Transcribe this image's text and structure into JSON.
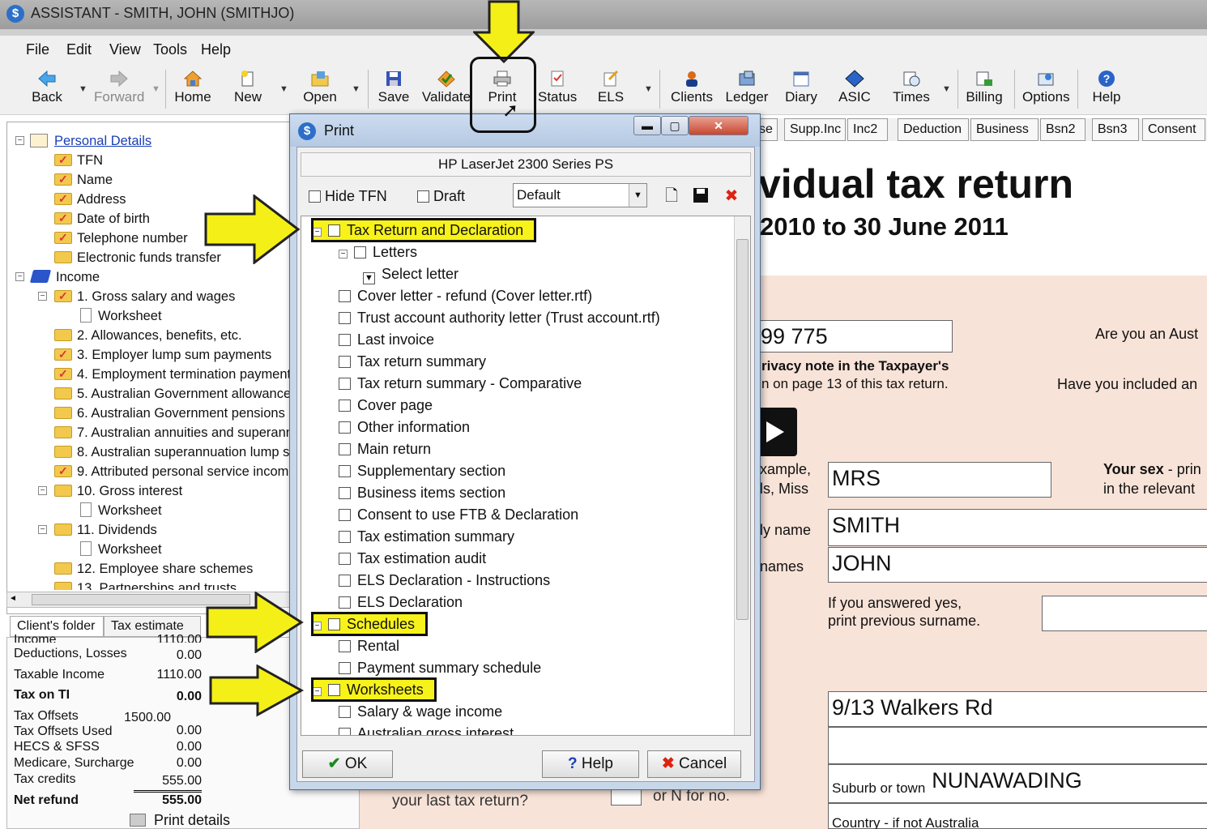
{
  "window": {
    "title": "ASSISTANT - SMITH, JOHN (SMITHJO)"
  },
  "menu": [
    "File",
    "Edit",
    "View",
    "Tools",
    "Help"
  ],
  "toolbar": [
    {
      "label": "Back",
      "icon": "back-arrow-icon"
    },
    {
      "label": "Forward",
      "icon": "forward-arrow-icon",
      "disabled": true
    },
    {
      "label": "Home",
      "icon": "home-icon"
    },
    {
      "label": "New",
      "icon": "new-icon"
    },
    {
      "label": "Open",
      "icon": "open-folder-icon"
    },
    {
      "label": "Save",
      "icon": "save-icon"
    },
    {
      "label": "Validate",
      "icon": "validate-icon"
    },
    {
      "label": "Print",
      "icon": "printer-icon"
    },
    {
      "label": "Status",
      "icon": "status-icon"
    },
    {
      "label": "ELS",
      "icon": "els-icon"
    },
    {
      "label": "Clients",
      "icon": "clients-icon"
    },
    {
      "label": "Ledger",
      "icon": "ledger-icon"
    },
    {
      "label": "Diary",
      "icon": "diary-icon"
    },
    {
      "label": "ASIC",
      "icon": "asic-icon"
    },
    {
      "label": "Times",
      "icon": "times-icon"
    },
    {
      "label": "Billing",
      "icon": "billing-icon"
    },
    {
      "label": "Options",
      "icon": "options-icon"
    },
    {
      "label": "Help",
      "icon": "help-icon"
    }
  ],
  "tree": [
    {
      "label": "Personal Details",
      "level": 0,
      "link": true
    },
    {
      "label": "TFN",
      "level": 1
    },
    {
      "label": "Name",
      "level": 1
    },
    {
      "label": "Address",
      "level": 1
    },
    {
      "label": "Date of birth",
      "level": 1
    },
    {
      "label": "Telephone number",
      "level": 1
    },
    {
      "label": "Electronic funds transfer",
      "level": 1
    },
    {
      "label": "Income",
      "level": 0
    },
    {
      "label": "1. Gross salary and wages",
      "level": 1
    },
    {
      "label": "Worksheet",
      "level": 2
    },
    {
      "label": "2. Allowances, benefits, etc.",
      "level": 1
    },
    {
      "label": "3. Employer lump sum payments",
      "level": 1
    },
    {
      "label": "4. Employment termination payments",
      "level": 1
    },
    {
      "label": "5. Australian Government allowances",
      "level": 1
    },
    {
      "label": "6. Australian Government pensions a",
      "level": 1
    },
    {
      "label": "7. Australian annuities and superann",
      "level": 1
    },
    {
      "label": "8. Australian superannuation lump su",
      "level": 1
    },
    {
      "label": "9. Attributed personal service income",
      "level": 1
    },
    {
      "label": "10. Gross interest",
      "level": 1
    },
    {
      "label": "Worksheet",
      "level": 2
    },
    {
      "label": "11. Dividends",
      "level": 1
    },
    {
      "label": "Worksheet",
      "level": 2
    },
    {
      "label": "12. Employee share schemes",
      "level": 1
    },
    {
      "label": "13. Partnerships and trusts",
      "level": 1
    }
  ],
  "left_tabs": [
    "Client's folder",
    "Tax estimate"
  ],
  "summary": {
    "rows": [
      {
        "label": "Income",
        "value": "1110.00"
      },
      {
        "label": "Deductions, Losses",
        "value": "0.00"
      },
      {
        "label": "Taxable Income",
        "value": "1110.00"
      },
      {
        "label": "Tax on TI",
        "value": "0.00",
        "bold": true
      },
      {
        "label": "Tax Offsets",
        "value": "1500.00"
      },
      {
        "label": "Tax Offsets Used",
        "value": "0.00"
      },
      {
        "label": "HECS & SFSS",
        "value": "0.00"
      },
      {
        "label": "Medicare, Surcharge",
        "value": "0.00"
      },
      {
        "label": "Tax credits",
        "value": "555.00"
      },
      {
        "label": "Net refund",
        "value": "555.00",
        "bold": true
      }
    ],
    "print_details": "Print details"
  },
  "right_tabs": [
    "se",
    "Supp.Inc",
    "Inc2",
    "Deduction",
    "Business",
    "Bsn2",
    "Bsn3",
    "Consent"
  ],
  "form": {
    "title": "vidual tax return",
    "subtitle": "2010 to 30 June 2011",
    "tfn_fragment": "99 775",
    "privacy_note_1": "rivacy note in the Taxpayer's",
    "privacy_note_2": "n on page 13 of this tax return.",
    "q_australian": "Are you an Aust",
    "q_included": "Have you included an",
    "title_label_1": "xample,",
    "title_label_2": "ls, Miss",
    "title_value": "MRS",
    "your_sex_1": "Your sex",
    "your_sex_2": "- prin",
    "your_sex_3": "in the relevant",
    "family_name_label": "ly name",
    "family_name": "SMITH",
    "given_names_label": "names",
    "given_names": "JOHN",
    "prev_surname_1": "If you answered yes,",
    "prev_surname_2": "print previous surname.",
    "address_line1": "9/13 Walkers Rd",
    "suburb_label": "Suburb or town",
    "suburb": "NUNAWADING",
    "country_label": "Country - if not Australia",
    "last_return_q": "your last tax return?",
    "or_n": "or N for no."
  },
  "print_dialog": {
    "title": "Print",
    "printer": "HP LaserJet 2300 Series PS",
    "hide_tfn": "Hide TFN",
    "draft": "Draft",
    "preset": "Default",
    "items": [
      {
        "label": "Tax Return and Declaration",
        "level": 0,
        "expander": true,
        "highlight": true
      },
      {
        "label": "Letters",
        "level": 1,
        "expander": true
      },
      {
        "label": "Select letter",
        "level": 2,
        "dropdown": true
      },
      {
        "label": "Cover letter - refund (Cover letter.rtf)",
        "level": 1
      },
      {
        "label": "Trust account authority letter (Trust account.rtf)",
        "level": 1
      },
      {
        "label": "Last invoice",
        "level": 1
      },
      {
        "label": "Tax return summary",
        "level": 1
      },
      {
        "label": "Tax return summary - Comparative",
        "level": 1
      },
      {
        "label": "Cover page",
        "level": 1
      },
      {
        "label": "Other information",
        "level": 1
      },
      {
        "label": "Main return",
        "level": 1
      },
      {
        "label": "Supplementary section",
        "level": 1
      },
      {
        "label": "Business items section",
        "level": 1
      },
      {
        "label": "Consent to use FTB & Declaration",
        "level": 1
      },
      {
        "label": "Tax estimation summary",
        "level": 1
      },
      {
        "label": "Tax estimation audit",
        "level": 1
      },
      {
        "label": "ELS Declaration - Instructions",
        "level": 1
      },
      {
        "label": "ELS Declaration",
        "level": 1
      },
      {
        "label": "Schedules",
        "level": 0,
        "expander": true,
        "highlight": true
      },
      {
        "label": "Rental",
        "level": 1
      },
      {
        "label": "Payment summary schedule",
        "level": 1
      },
      {
        "label": "Worksheets",
        "level": 0,
        "expander": true,
        "highlight": true
      },
      {
        "label": "Salary & wage income",
        "level": 1
      },
      {
        "label": "Australian gross interest",
        "level": 1
      }
    ],
    "ok": "OK",
    "help": "Help",
    "cancel": "Cancel"
  },
  "colors": {
    "highlight": "#f7f21a",
    "arrow": "#f5ef18",
    "form_pink": "#f8e3d8"
  }
}
